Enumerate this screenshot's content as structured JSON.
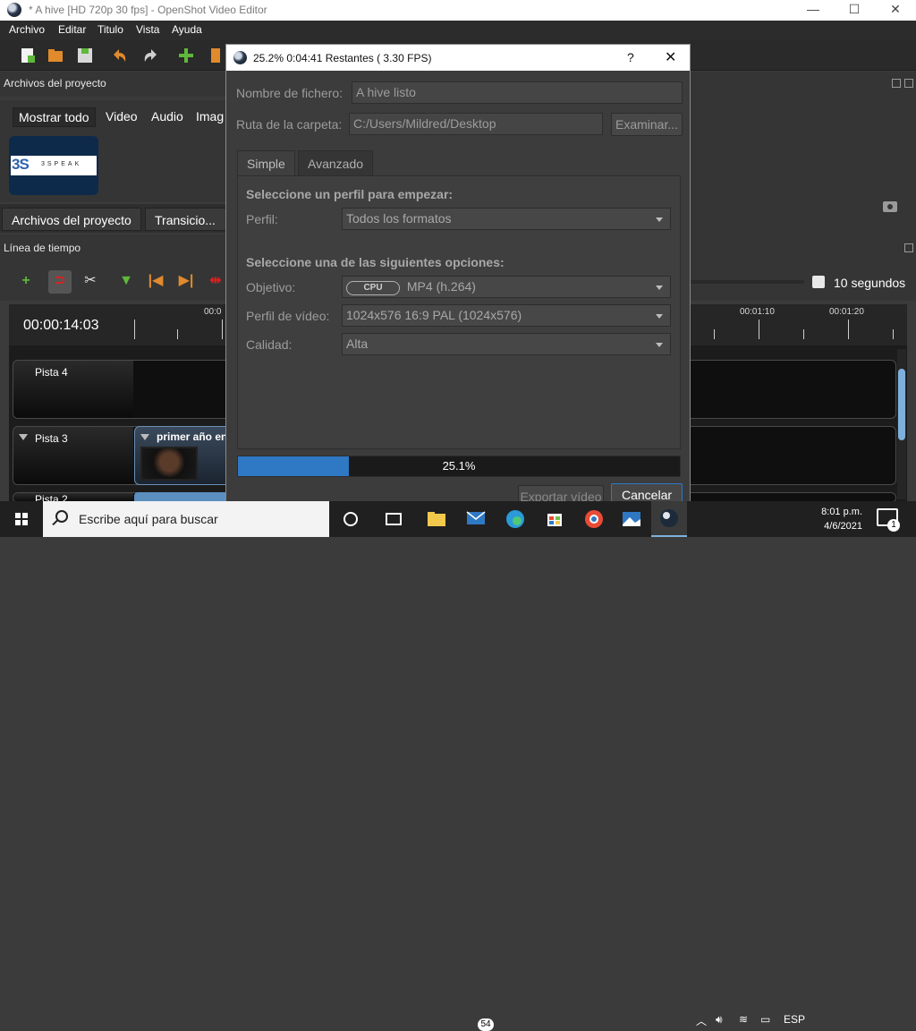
{
  "window": {
    "title": "* A hive [HD 720p 30 fps] - OpenShot Video Editor",
    "minimize": "—",
    "maximize": "☐",
    "close": "✕"
  },
  "menu": {
    "items": [
      "Archivo",
      "Editar",
      "Titulo",
      "Vista",
      "Ayuda"
    ]
  },
  "project_panel": {
    "header": "Archivos del proyecto",
    "filters": [
      "Mostrar todo",
      "Video",
      "Audio",
      "Imag"
    ],
    "file_logo_text": "3SPEAK",
    "tabs": [
      "Archivos del proyecto",
      "Transicio..."
    ]
  },
  "timeline": {
    "header": "Línea de tiempo",
    "timecode": "00:00:14:03",
    "ruler_labels": [
      "00:0",
      "00:01:10",
      "00:01:20"
    ],
    "zoom_label": "10 segundos",
    "tracks": [
      {
        "name": "Pista 4"
      },
      {
        "name": "Pista 3",
        "clip": "primer año en"
      },
      {
        "name": "Pista 2"
      }
    ]
  },
  "dialog": {
    "title": "25.2%  0:04:41 Restantes ( 3.30 FPS)",
    "help": "?",
    "close": "✕",
    "filename_label": "Nombre de fichero:",
    "filename_value": "A hive listo",
    "folder_label": "Ruta de la carpeta:",
    "folder_value": "C:/Users/Mildred/Desktop",
    "browse_button": "Examinar...",
    "tabs": [
      "Simple",
      "Avanzado"
    ],
    "profile_section": "Seleccione un perfil para empezar:",
    "profile_label": "Perfil:",
    "profile_value": "Todos los formatos",
    "options_section": "Seleccione una de las siguientes opciones:",
    "target_label": "Objetivo:",
    "target_badge": "CPU",
    "target_value": "MP4 (h.264)",
    "video_profile_label": "Perfil de vídeo:",
    "video_profile_value": "1024x576 16:9 PAL (1024x576)",
    "quality_label": "Calidad:",
    "quality_value": "Alta",
    "progress": 0.251,
    "progress_text": "25.1%",
    "export_button": "Exportar vídeo",
    "cancel_button": "Cancelar"
  },
  "taskbar": {
    "search_placeholder": "Escribe aquí para buscar",
    "mail_badge": "54",
    "language": "ESP",
    "time": "8:01 p.m.",
    "date": "4/6/2021",
    "notification_count": "1"
  },
  "colors": {
    "accent": "#2f78c4",
    "window_bg": "#3b3b3b",
    "dialog_bg": "#3c3c3c"
  }
}
